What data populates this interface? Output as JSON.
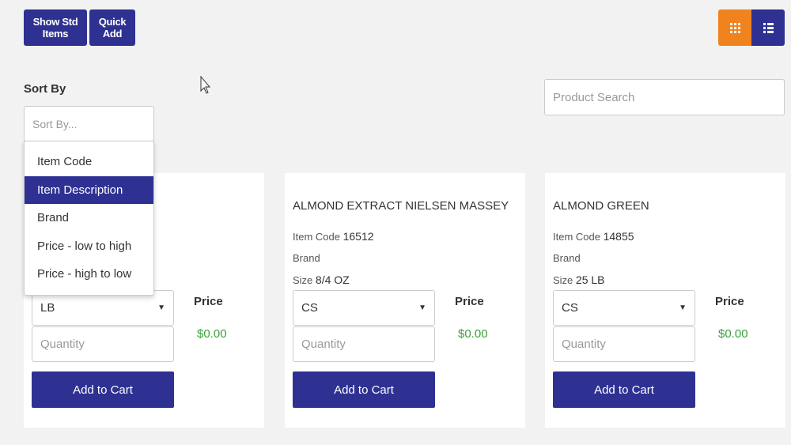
{
  "toolbar": {
    "show_std_items": "Show Std Items",
    "quick_add": "Quick Add",
    "grid_view_icon": "grid-icon",
    "list_view_icon": "list-icon",
    "active_view_color": "#f0831e"
  },
  "sort": {
    "label": "Sort By",
    "placeholder": "Sort By...",
    "options": [
      "Item Code",
      "Item Description",
      "Brand",
      "Price - low to high",
      "Price - high to low"
    ],
    "highlighted": "Item Description"
  },
  "search": {
    "placeholder": "Product Search"
  },
  "theme": {
    "primary": "#2e3192",
    "accent": "#f0831e",
    "price_color": "#3aa03a"
  },
  "products": [
    {
      "title": "",
      "item_code_label": "",
      "item_code": "",
      "brand_label": "",
      "size_label": "",
      "size": "",
      "uom": "LB",
      "quantity_placeholder": "Quantity",
      "price_label": "Price",
      "price": "$0.00",
      "add_to_cart": "Add to Cart"
    },
    {
      "title": "ALMOND EXTRACT NIELSEN MASSEY",
      "item_code_label": "Item Code",
      "item_code": "16512",
      "brand_label": "Brand",
      "size_label": "Size",
      "size": "8/4 OZ",
      "uom": "CS",
      "quantity_placeholder": "Quantity",
      "price_label": "Price",
      "price": "$0.00",
      "add_to_cart": "Add to Cart"
    },
    {
      "title": "ALMOND GREEN",
      "item_code_label": "Item Code",
      "item_code": "14855",
      "brand_label": "Brand",
      "size_label": "Size",
      "size": "25 LB",
      "uom": "CS",
      "quantity_placeholder": "Quantity",
      "price_label": "Price",
      "price": "$0.00",
      "add_to_cart": "Add to Cart"
    }
  ]
}
